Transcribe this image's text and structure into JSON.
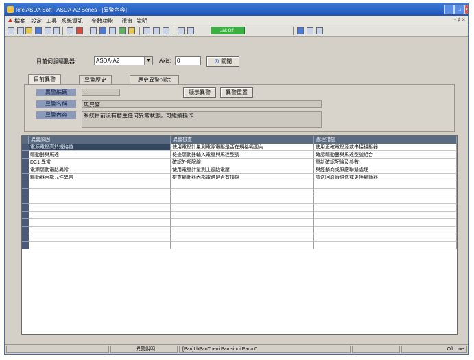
{
  "window": {
    "title": "Icfe ASDA Soft - ASDA-A2 Series - [異警內容]",
    "controls": [
      "_",
      "□",
      "×"
    ]
  },
  "menu": {
    "items": [
      "檔案",
      "設定",
      "工具",
      "系統資訊",
      "參數功能",
      "視窗",
      "說明"
    ],
    "close_glyph": "- ♯ ×"
  },
  "toolbar": {
    "status_field": "Link Off"
  },
  "form": {
    "drive_label": "目前伺服驅動器:",
    "drive_value": "ASDA-A2",
    "axis_label": "Axis:",
    "axis_value": "0",
    "close_button": "關閉"
  },
  "tabs": [
    {
      "label": "目前異警"
    },
    {
      "label": "異警歷史"
    },
    {
      "label": "歷史異警排除"
    }
  ],
  "details": {
    "code_label": "異警編碼",
    "code_value": "--",
    "name_label": "異警名稱",
    "name_value": "無異警",
    "content_label": "異警內容",
    "content_value": "系統目前沒有發生任何異常狀態，可繼續操作",
    "reset_button": "顯示異警",
    "clear_button": "異警重置"
  },
  "grid": {
    "columns": [
      "異警原因",
      "異警檢查",
      "處理措施"
    ],
    "rows": [
      [
        "電源電壓高於規格值",
        "使用電壓計量測電源電壓是否在規格範圍內",
        "使用正確電壓源或串接穩壓器"
      ],
      [
        "驅動器與馬達",
        "檢查驅動器輸入電壓與馬達型號",
        "確認驅動器與馬達型號組合"
      ],
      [
        "DC1 異常",
        "確認外部配線",
        "重新確認配線及參數"
      ],
      [
        "電源驅動電路異常",
        "使用電壓計量測主迴路電壓",
        "與經銷商或原廠聯繫處理"
      ],
      [
        "驅動器內部元件異常",
        "檢查驅動器內部電路是否有損傷",
        "請送回原廠維修或更換驅動器"
      ]
    ],
    "empty_rows": 9
  },
  "status": {
    "left": "",
    "mid": "異警說明",
    "path": "[Pan]LbPanTheni Pamsindi Pana 0",
    "right": "Off Line"
  }
}
